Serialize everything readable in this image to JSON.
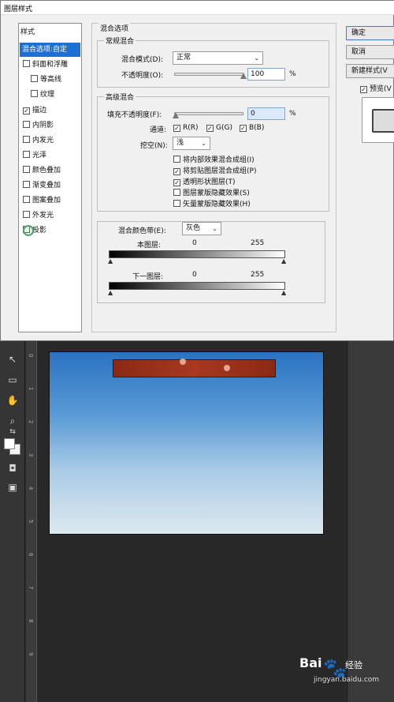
{
  "dialog": {
    "title": "图层样式",
    "styles_header": "样式",
    "style_items": [
      {
        "label": "混合选项:自定",
        "checked": null,
        "selected": true
      },
      {
        "label": "斜面和浮雕",
        "checked": false
      },
      {
        "label": "等高线",
        "checked": false,
        "indent": true
      },
      {
        "label": "纹理",
        "checked": false,
        "indent": true
      },
      {
        "label": "描边",
        "checked": true
      },
      {
        "label": "内阴影",
        "checked": false
      },
      {
        "label": "内发光",
        "checked": false
      },
      {
        "label": "光泽",
        "checked": false
      },
      {
        "label": "颜色叠加",
        "checked": false
      },
      {
        "label": "渐变叠加",
        "checked": false
      },
      {
        "label": "图案叠加",
        "checked": false
      },
      {
        "label": "外发光",
        "checked": false
      },
      {
        "label": "投影",
        "checked": false
      }
    ],
    "blend_options_title": "混合选项",
    "general_blend": {
      "title": "常规混合",
      "mode_label": "混合模式(D):",
      "mode_value": "正常",
      "opacity_label": "不透明度(O):",
      "opacity_value": "100",
      "percent": "%"
    },
    "advanced_blend": {
      "title": "高级混合",
      "fill_opacity_label": "填充不透明度(F):",
      "fill_opacity_value": "0",
      "percent": "%",
      "channels_label": "通道:",
      "channel_r": "R(R)",
      "channel_g": "G(G)",
      "channel_b": "B(B)",
      "knockout_label": "挖空(N):",
      "knockout_value": "浅",
      "options": [
        {
          "label": "将内部效果混合成组(I)",
          "checked": false
        },
        {
          "label": "将剪贴图层混合成组(P)",
          "checked": true
        },
        {
          "label": "透明形状图层(T)",
          "checked": true
        },
        {
          "label": "图层蒙版隐藏效果(S)",
          "checked": false
        },
        {
          "label": "矢量蒙版隐藏效果(H)",
          "checked": false
        }
      ]
    },
    "blend_if": {
      "label": "混合颜色带(E):",
      "value": "灰色",
      "this_layer_label": "本图层:",
      "this_layer_min": "0",
      "this_layer_max": "255",
      "underlying_label": "下一图层:",
      "underlying_min": "0",
      "underlying_max": "255"
    },
    "buttons": {
      "ok": "确定",
      "cancel": "取消",
      "new_style": "新建样式(V",
      "preview_label": "预览(V"
    }
  },
  "watermark": {
    "brand": "Bai",
    "brand_tail": "经验",
    "url": "jingyan.baidu.com"
  },
  "ruler_numbers": [
    "0",
    "1",
    "2",
    "3",
    "4",
    "5",
    "6",
    "7",
    "8",
    "9"
  ]
}
